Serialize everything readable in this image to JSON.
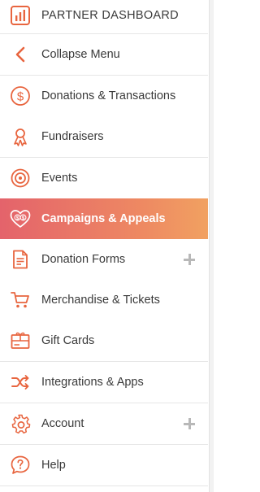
{
  "colors": {
    "accent": "#e8653f",
    "active_gradient_start": "#e4636b",
    "active_gradient_end": "#f1a161"
  },
  "sidebar": {
    "items": [
      {
        "label": "PARTNER DASHBOARD",
        "icon": "bar-chart-icon"
      },
      {
        "label": "Collapse Menu",
        "icon": "chevron-left-icon"
      },
      {
        "label": "Donations & Transactions",
        "icon": "dollar-circle-icon"
      },
      {
        "label": "Fundraisers",
        "icon": "ribbon-icon"
      },
      {
        "label": "Events",
        "icon": "target-icon"
      },
      {
        "label": "Campaigns & Appeals",
        "icon": "heart-dollar-icon",
        "active": true
      },
      {
        "label": "Donation Forms",
        "icon": "document-icon",
        "expandable": true
      },
      {
        "label": "Merchandise & Tickets",
        "icon": "cart-icon"
      },
      {
        "label": "Gift Cards",
        "icon": "gift-card-icon"
      },
      {
        "label": "Integrations & Apps",
        "icon": "shuffle-icon"
      },
      {
        "label": "Account",
        "icon": "gear-icon",
        "expandable": true
      },
      {
        "label": "Help",
        "icon": "help-icon"
      }
    ]
  }
}
